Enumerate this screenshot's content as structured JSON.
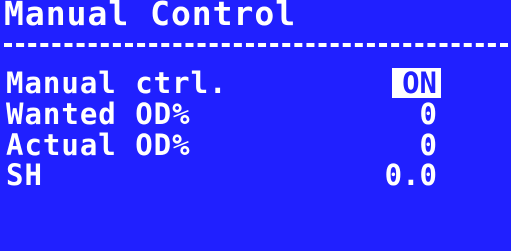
{
  "screen": {
    "title": "Manual Control",
    "background_color": "#2020ff",
    "text_color": "#ffffff"
  },
  "rows": [
    {
      "label": "Manual ctrl.",
      "value": "ON",
      "selected": true
    },
    {
      "label": "Wanted OD%",
      "value": "0",
      "selected": false
    },
    {
      "label": "Actual OD%",
      "value": "0",
      "selected": false
    },
    {
      "label": "SH",
      "value": "0.0",
      "selected": false
    }
  ]
}
